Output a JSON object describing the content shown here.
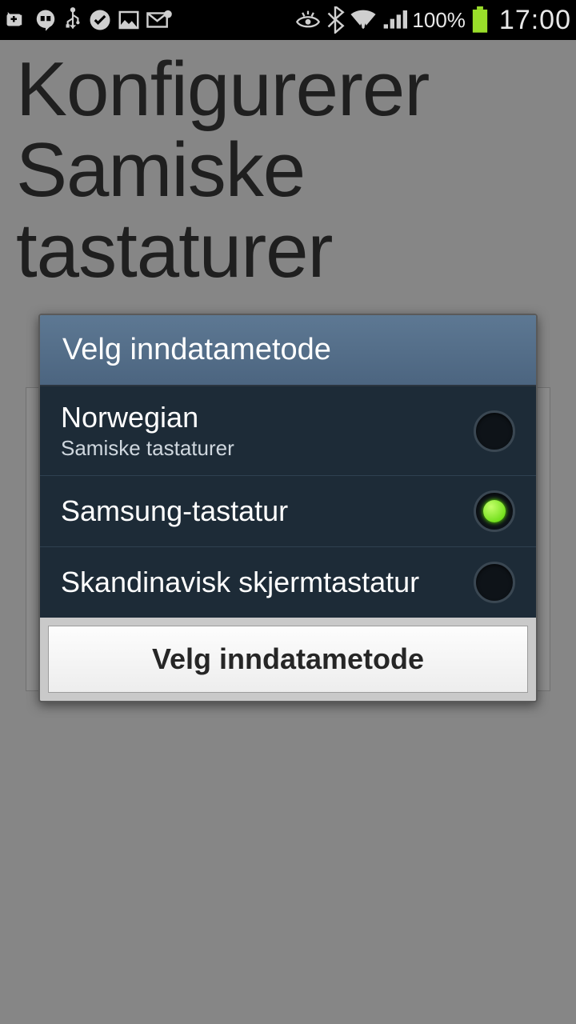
{
  "status_bar": {
    "battery_pct": "100%",
    "clock": "17:00"
  },
  "page": {
    "title": "Konfigurerer Samiske tastaturer"
  },
  "dialog": {
    "title": "Velg inndatametode",
    "options": [
      {
        "title": "Norwegian",
        "subtitle": "Samiske tastaturer",
        "checked": false
      },
      {
        "title": "Samsung-tastatur",
        "subtitle": "",
        "checked": true
      },
      {
        "title": "Skandinavisk skjermtastatur",
        "subtitle": "",
        "checked": false
      }
    ],
    "footer_button": "Velg inndatametode"
  }
}
